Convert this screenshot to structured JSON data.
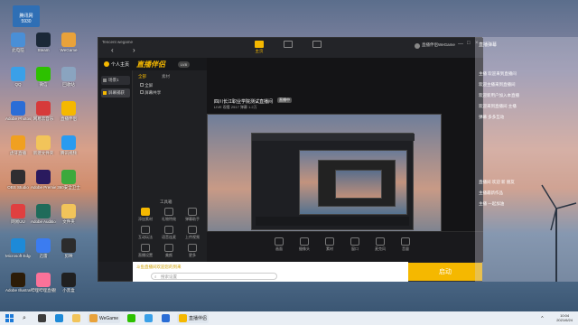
{
  "desktop": {
    "icons": [
      {
        "label": "此电脑",
        "color": "#4a8fd6"
      },
      {
        "label": "Steam",
        "color": "#1b2838"
      },
      {
        "label": "WeGame",
        "color": "#e9a23a"
      },
      {
        "label": "QQ",
        "color": "#3aa0e8"
      },
      {
        "label": "微信",
        "color": "#2dc100"
      },
      {
        "label": "回收站",
        "color": "#8aa4c0"
      },
      {
        "label": "Adobe Photoshop",
        "color": "#2a6dd6"
      },
      {
        "label": "网易云音乐",
        "color": "#d63a3a"
      },
      {
        "label": "直播伴侣",
        "color": "#f5b800"
      },
      {
        "label": "虎牙直播",
        "color": "#f0a020"
      },
      {
        "label": "新建文件夹",
        "color": "#f2c45a"
      },
      {
        "label": "腾讯视频",
        "color": "#2a9bf0"
      },
      {
        "label": "OBS Studio",
        "color": "#302e31"
      },
      {
        "label": "Adobe Premiere",
        "color": "#2a1a5e"
      },
      {
        "label": "360安全卫士",
        "color": "#3ca93c"
      },
      {
        "label": "网易UU",
        "color": "#e04040"
      },
      {
        "label": "Adobe Audition",
        "color": "#1f6b5a"
      },
      {
        "label": "文件夹",
        "color": "#f2c45a"
      },
      {
        "label": "Microsoft Edge",
        "color": "#1d8ad8"
      },
      {
        "label": "迅雷",
        "color": "#3b7cf0"
      },
      {
        "label": "剪映",
        "color": "#2c2c2c"
      },
      {
        "label": "Adobe Illustrator",
        "color": "#2c1c08"
      },
      {
        "label": "哔哩哔哩直播姬",
        "color": "#fb7299"
      },
      {
        "label": "小黑盒",
        "color": "#202020"
      }
    ],
    "user_badge": "腾讯网",
    "user_badge_sub": "5930"
  },
  "app": {
    "window_title": "Tencent wegame",
    "logo_text": "直播伴侣",
    "personal_label": "个人主页",
    "level_badge": "LV8",
    "nav": [
      {
        "label": "主页",
        "icon": "home-icon"
      },
      {
        "label": "",
        "icon": "video-icon"
      },
      {
        "label": "",
        "icon": "record-icon"
      }
    ],
    "scenes": [
      {
        "label": "场景1"
      },
      {
        "label": "屏幕捕获"
      },
      {
        "label": "摄像头"
      }
    ],
    "source_tabs": [
      "全部",
      "素材"
    ],
    "source_items": [
      {
        "label": "全屏"
      },
      {
        "label": "屏幕共享"
      }
    ],
    "tool_section_title": "工具箱",
    "tools": [
      {
        "label": "添加素材"
      },
      {
        "label": "礼物特效"
      },
      {
        "label": "弹幕助手"
      },
      {
        "label": "互动玩法"
      },
      {
        "label": "语音连麦"
      },
      {
        "label": "上传视频"
      },
      {
        "label": "直播设置"
      },
      {
        "label": "美颜"
      },
      {
        "label": "更多"
      }
    ],
    "preview_header": "四川长江职业学院测试直播间",
    "preview_status": "直播中",
    "preview_stats": "LIVE  观看 2517  弹幕 1.2万",
    "bottom_controls": [
      {
        "label": "画面",
        "icon": "screen-icon"
      },
      {
        "label": "摄像头",
        "icon": "camera-icon"
      },
      {
        "label": "素材",
        "icon": "material-icon"
      },
      {
        "label": "窗口",
        "icon": "window-icon"
      },
      {
        "label": "麦克风",
        "icon": "mic-icon"
      },
      {
        "label": "音量",
        "icon": "volume-icon"
      }
    ],
    "search_placeholder": "搜索设置",
    "announce_text": "斗鱼直播间欢迎您的到来",
    "start_label": "启动",
    "user_name": "直播伴侣WeGame",
    "accent": "#f5b800"
  },
  "chat": {
    "title": "直播弹幕",
    "lines": [
      "主播 欢迎来到直播间",
      "欢迎主播来到直播间",
      "欢迎新用户加入本直播",
      "欢迎来到直播间 主播",
      "弹幕 多多互动",
      "直播间 欢迎 新 朋友",
      "主播最新作品",
      "主播 一起加油"
    ]
  },
  "taskbar": {
    "items": [
      {
        "label": "",
        "icon": "windows-icon"
      },
      {
        "label": "",
        "icon": "search-icon"
      },
      {
        "label": "WeGame",
        "icon": "wegame-icon"
      },
      {
        "label": "直播伴侣",
        "icon": "live-icon"
      }
    ],
    "time": "10:04",
    "date": "2021/6/24"
  }
}
